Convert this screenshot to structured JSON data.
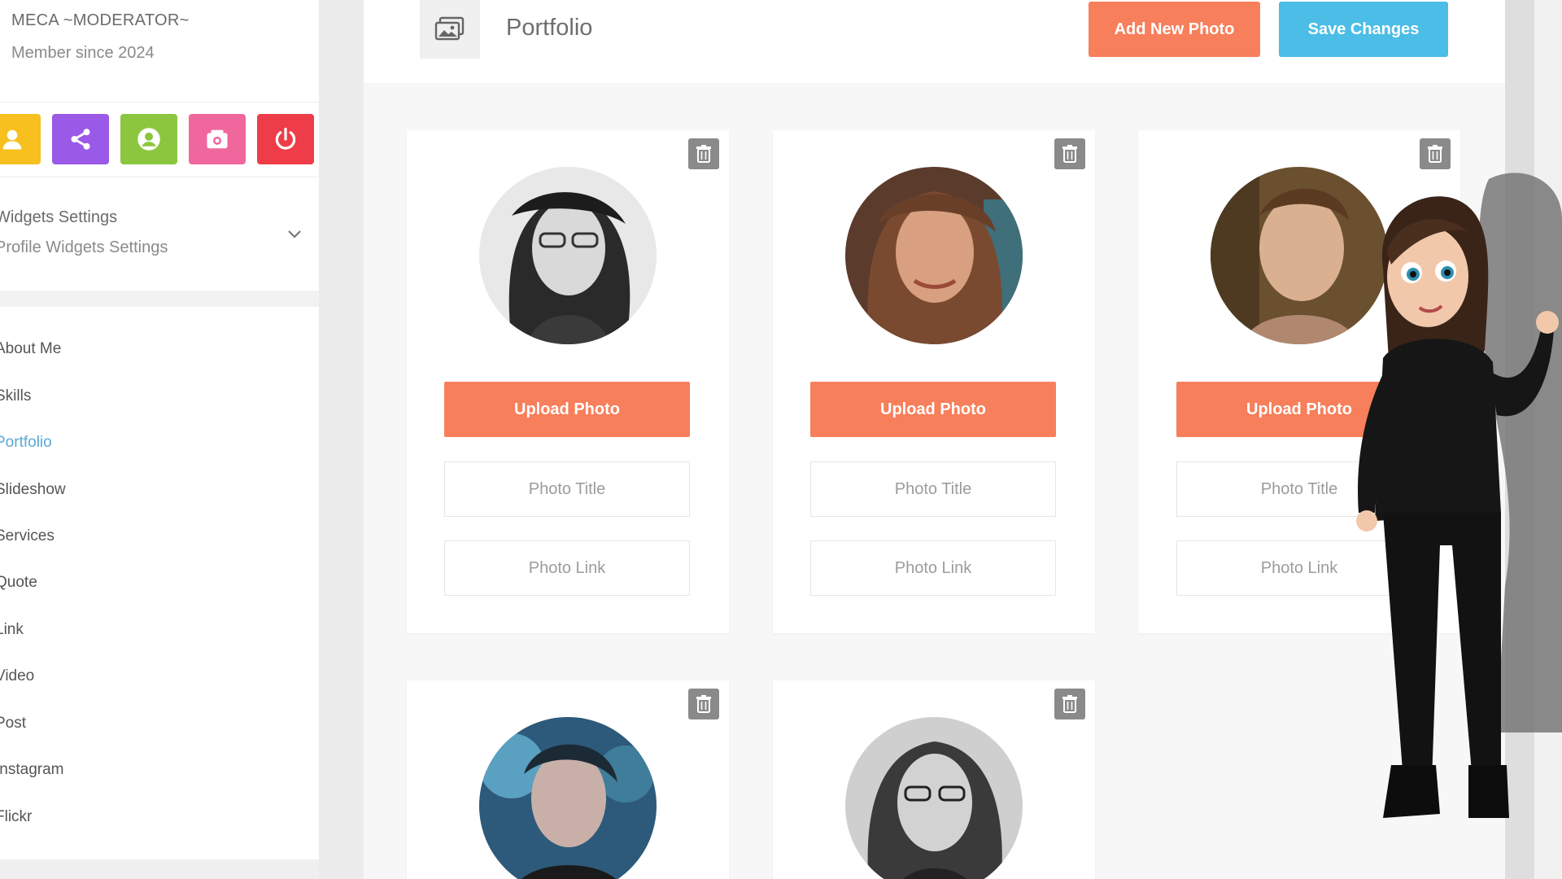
{
  "profile": {
    "name": "MECA ~MODERATOR~",
    "member_since": "Member since 2024"
  },
  "quick_actions": [
    {
      "icon": "user-icon",
      "color": "#f7c01f"
    },
    {
      "icon": "share-icon",
      "color": "#9b59e8"
    },
    {
      "icon": "user-circle-icon",
      "color": "#8cc63f"
    },
    {
      "icon": "camera-icon",
      "color": "#f0679e"
    },
    {
      "icon": "power-icon",
      "color": "#ee3d48"
    }
  ],
  "widgets": {
    "title": "Widgets Settings",
    "subtitle": "Profile Widgets Settings"
  },
  "menu": {
    "items": [
      {
        "label": "About Me"
      },
      {
        "label": "Skills"
      },
      {
        "label": "Portfolio"
      },
      {
        "label": "Slideshow"
      },
      {
        "label": "Services"
      },
      {
        "label": "Quote"
      },
      {
        "label": "Link"
      },
      {
        "label": "Video"
      },
      {
        "label": "Post"
      },
      {
        "label": "Instagram"
      },
      {
        "label": "Flickr"
      }
    ],
    "active": "Portfolio"
  },
  "header": {
    "icon": "image-gallery-icon",
    "title": "Portfolio",
    "add_label": "Add New Photo",
    "save_label": "Save Changes"
  },
  "cards": [
    {
      "upload_label": "Upload Photo",
      "title_placeholder": "Photo Title",
      "link_placeholder": "Photo Link"
    },
    {
      "upload_label": "Upload Photo",
      "title_placeholder": "Photo Title",
      "link_placeholder": "Photo Link"
    },
    {
      "upload_label": "Upload Photo",
      "title_placeholder": "Photo Title",
      "link_placeholder": "Photo Link"
    }
  ],
  "colors": {
    "accent_orange": "#f77f5b",
    "accent_blue": "#4bbde6",
    "active_link": "#5aa9d6"
  }
}
